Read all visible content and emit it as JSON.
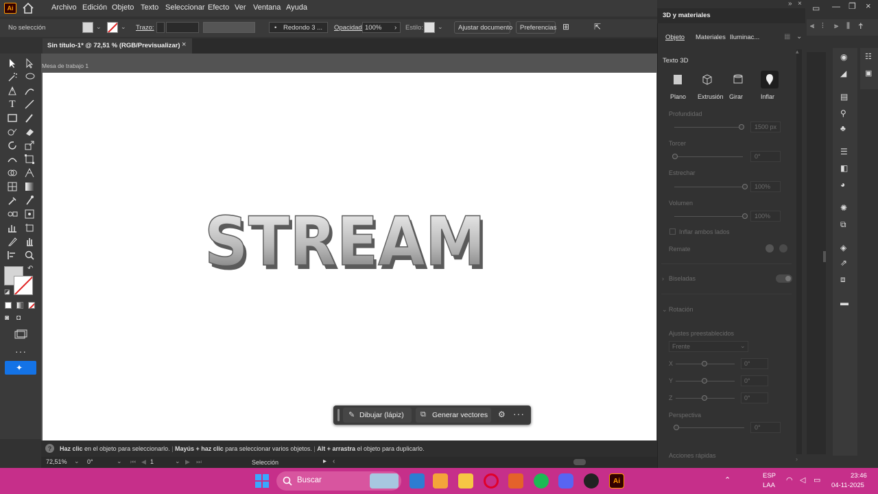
{
  "menu": {
    "app_logo": "Ai",
    "items": [
      "Archivo",
      "Edición",
      "Objeto",
      "Texto",
      "Seleccionar",
      "Efecto",
      "Ver",
      "Ventana",
      "Ayuda"
    ]
  },
  "control_bar": {
    "selection": "No selección",
    "stroke_label": "Trazo:",
    "brush": "Redondo 3 ...",
    "opacity_label": "Opacidad:",
    "opacity_value": "100%",
    "style_label": "Estilo:",
    "doc_setup": "Ajustar documento",
    "prefs": "Preferencias"
  },
  "document": {
    "tab_title": "Sin título-1* @ 72,51 % (RGB/Previsualizar)",
    "artboard_label": "Mesa de trabajo 1",
    "art_text": "STREAM"
  },
  "context_bar": {
    "draw": "Dibujar (lápiz)",
    "generate": "Generar vectores"
  },
  "status": {
    "hint_a_bold": "Haz clic",
    "hint_a": " en el objeto para seleccionarlo.",
    "hint_b_bold": "Mayús + haz clic",
    "hint_b": " para seleccionar varios objetos.",
    "hint_c_bold": "Alt + arrastra",
    "hint_c": " el objeto para duplicarlo.",
    "zoom": "72,51%",
    "rotation": "0°",
    "artboard_num": "1",
    "tool": "Selección"
  },
  "panel": {
    "title": "3D y materiales",
    "tabs": [
      "Objeto",
      "Materiales",
      "Iluminac..."
    ],
    "section": "Texto 3D",
    "types": [
      "Plano",
      "Extrusión",
      "Girar",
      "Inflar"
    ],
    "depth_label": "Profundidad",
    "depth_value": "1500 px",
    "twist_label": "Torcer",
    "twist_value": "0°",
    "taper_label": "Estrechar",
    "taper_value": "100%",
    "volume_label": "Volumen",
    "volume_value": "100%",
    "both_sides": "Inflar ambos lados",
    "cap_label": "Remate",
    "bevels": "Biseladas",
    "rotation": "Rotación",
    "presets_label": "Ajustes preestablecidos",
    "preset_value": "Frente",
    "x_label": "X",
    "x_value": "0°",
    "y_label": "Y",
    "y_value": "0°",
    "z_label": "Z",
    "z_value": "0°",
    "perspective_label": "Perspectiva",
    "perspective_value": "0°",
    "quick_actions": "Acciones rápidas"
  },
  "taskbar": {
    "search": "Buscar",
    "lang1": "ESP",
    "lang2": "LAA",
    "time": "23:46",
    "date": "04-11-2025"
  },
  "colors": {
    "taskbar": "#c62f8a",
    "accent": "#1473e6",
    "ai_orange": "#ff9a00"
  }
}
